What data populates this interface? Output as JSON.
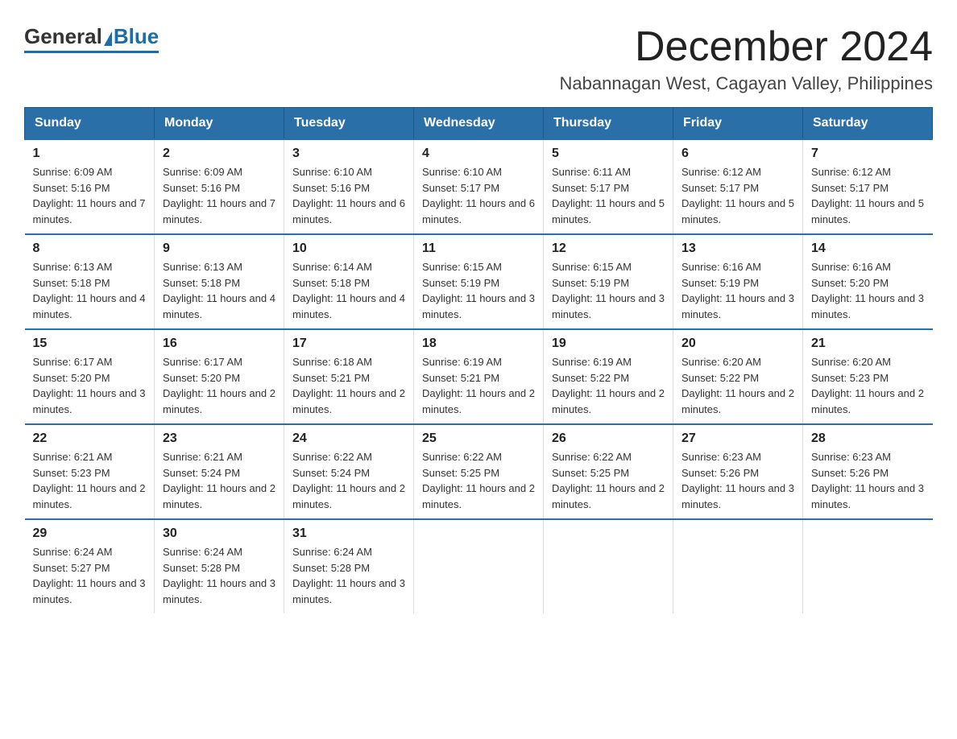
{
  "logo": {
    "general": "General",
    "blue": "Blue"
  },
  "header": {
    "month": "December 2024",
    "location": "Nabannagan West, Cagayan Valley, Philippines"
  },
  "days_of_week": [
    "Sunday",
    "Monday",
    "Tuesday",
    "Wednesday",
    "Thursday",
    "Friday",
    "Saturday"
  ],
  "weeks": [
    [
      {
        "day": "1",
        "sunrise": "Sunrise: 6:09 AM",
        "sunset": "Sunset: 5:16 PM",
        "daylight": "Daylight: 11 hours and 7 minutes."
      },
      {
        "day": "2",
        "sunrise": "Sunrise: 6:09 AM",
        "sunset": "Sunset: 5:16 PM",
        "daylight": "Daylight: 11 hours and 7 minutes."
      },
      {
        "day": "3",
        "sunrise": "Sunrise: 6:10 AM",
        "sunset": "Sunset: 5:16 PM",
        "daylight": "Daylight: 11 hours and 6 minutes."
      },
      {
        "day": "4",
        "sunrise": "Sunrise: 6:10 AM",
        "sunset": "Sunset: 5:17 PM",
        "daylight": "Daylight: 11 hours and 6 minutes."
      },
      {
        "day": "5",
        "sunrise": "Sunrise: 6:11 AM",
        "sunset": "Sunset: 5:17 PM",
        "daylight": "Daylight: 11 hours and 5 minutes."
      },
      {
        "day": "6",
        "sunrise": "Sunrise: 6:12 AM",
        "sunset": "Sunset: 5:17 PM",
        "daylight": "Daylight: 11 hours and 5 minutes."
      },
      {
        "day": "7",
        "sunrise": "Sunrise: 6:12 AM",
        "sunset": "Sunset: 5:17 PM",
        "daylight": "Daylight: 11 hours and 5 minutes."
      }
    ],
    [
      {
        "day": "8",
        "sunrise": "Sunrise: 6:13 AM",
        "sunset": "Sunset: 5:18 PM",
        "daylight": "Daylight: 11 hours and 4 minutes."
      },
      {
        "day": "9",
        "sunrise": "Sunrise: 6:13 AM",
        "sunset": "Sunset: 5:18 PM",
        "daylight": "Daylight: 11 hours and 4 minutes."
      },
      {
        "day": "10",
        "sunrise": "Sunrise: 6:14 AM",
        "sunset": "Sunset: 5:18 PM",
        "daylight": "Daylight: 11 hours and 4 minutes."
      },
      {
        "day": "11",
        "sunrise": "Sunrise: 6:15 AM",
        "sunset": "Sunset: 5:19 PM",
        "daylight": "Daylight: 11 hours and 3 minutes."
      },
      {
        "day": "12",
        "sunrise": "Sunrise: 6:15 AM",
        "sunset": "Sunset: 5:19 PM",
        "daylight": "Daylight: 11 hours and 3 minutes."
      },
      {
        "day": "13",
        "sunrise": "Sunrise: 6:16 AM",
        "sunset": "Sunset: 5:19 PM",
        "daylight": "Daylight: 11 hours and 3 minutes."
      },
      {
        "day": "14",
        "sunrise": "Sunrise: 6:16 AM",
        "sunset": "Sunset: 5:20 PM",
        "daylight": "Daylight: 11 hours and 3 minutes."
      }
    ],
    [
      {
        "day": "15",
        "sunrise": "Sunrise: 6:17 AM",
        "sunset": "Sunset: 5:20 PM",
        "daylight": "Daylight: 11 hours and 3 minutes."
      },
      {
        "day": "16",
        "sunrise": "Sunrise: 6:17 AM",
        "sunset": "Sunset: 5:20 PM",
        "daylight": "Daylight: 11 hours and 2 minutes."
      },
      {
        "day": "17",
        "sunrise": "Sunrise: 6:18 AM",
        "sunset": "Sunset: 5:21 PM",
        "daylight": "Daylight: 11 hours and 2 minutes."
      },
      {
        "day": "18",
        "sunrise": "Sunrise: 6:19 AM",
        "sunset": "Sunset: 5:21 PM",
        "daylight": "Daylight: 11 hours and 2 minutes."
      },
      {
        "day": "19",
        "sunrise": "Sunrise: 6:19 AM",
        "sunset": "Sunset: 5:22 PM",
        "daylight": "Daylight: 11 hours and 2 minutes."
      },
      {
        "day": "20",
        "sunrise": "Sunrise: 6:20 AM",
        "sunset": "Sunset: 5:22 PM",
        "daylight": "Daylight: 11 hours and 2 minutes."
      },
      {
        "day": "21",
        "sunrise": "Sunrise: 6:20 AM",
        "sunset": "Sunset: 5:23 PM",
        "daylight": "Daylight: 11 hours and 2 minutes."
      }
    ],
    [
      {
        "day": "22",
        "sunrise": "Sunrise: 6:21 AM",
        "sunset": "Sunset: 5:23 PM",
        "daylight": "Daylight: 11 hours and 2 minutes."
      },
      {
        "day": "23",
        "sunrise": "Sunrise: 6:21 AM",
        "sunset": "Sunset: 5:24 PM",
        "daylight": "Daylight: 11 hours and 2 minutes."
      },
      {
        "day": "24",
        "sunrise": "Sunrise: 6:22 AM",
        "sunset": "Sunset: 5:24 PM",
        "daylight": "Daylight: 11 hours and 2 minutes."
      },
      {
        "day": "25",
        "sunrise": "Sunrise: 6:22 AM",
        "sunset": "Sunset: 5:25 PM",
        "daylight": "Daylight: 11 hours and 2 minutes."
      },
      {
        "day": "26",
        "sunrise": "Sunrise: 6:22 AM",
        "sunset": "Sunset: 5:25 PM",
        "daylight": "Daylight: 11 hours and 2 minutes."
      },
      {
        "day": "27",
        "sunrise": "Sunrise: 6:23 AM",
        "sunset": "Sunset: 5:26 PM",
        "daylight": "Daylight: 11 hours and 3 minutes."
      },
      {
        "day": "28",
        "sunrise": "Sunrise: 6:23 AM",
        "sunset": "Sunset: 5:26 PM",
        "daylight": "Daylight: 11 hours and 3 minutes."
      }
    ],
    [
      {
        "day": "29",
        "sunrise": "Sunrise: 6:24 AM",
        "sunset": "Sunset: 5:27 PM",
        "daylight": "Daylight: 11 hours and 3 minutes."
      },
      {
        "day": "30",
        "sunrise": "Sunrise: 6:24 AM",
        "sunset": "Sunset: 5:28 PM",
        "daylight": "Daylight: 11 hours and 3 minutes."
      },
      {
        "day": "31",
        "sunrise": "Sunrise: 6:24 AM",
        "sunset": "Sunset: 5:28 PM",
        "daylight": "Daylight: 11 hours and 3 minutes."
      },
      null,
      null,
      null,
      null
    ]
  ]
}
